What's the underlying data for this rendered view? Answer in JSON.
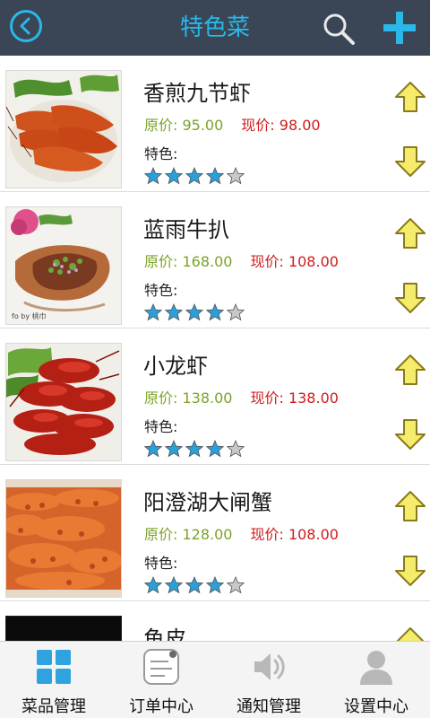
{
  "header": {
    "title": "特色菜",
    "accent_color": "#2ab8ea",
    "background": "#3a4656",
    "back_icon": "back-circle-icon",
    "search_icon": "search-icon",
    "add_icon": "plus-icon"
  },
  "items": [
    {
      "name": "香煎九节虾",
      "orig_label": "原价: 95.00",
      "now_label": "现价: 98.00",
      "feature": "特色:",
      "rating": 4,
      "max_rating": 5
    },
    {
      "name": "蓝雨牛扒",
      "orig_label": "原价: 168.00",
      "now_label": "现价: 108.00",
      "feature": "特色:",
      "rating": 4,
      "max_rating": 5
    },
    {
      "name": "小龙虾",
      "orig_label": "原价: 138.00",
      "now_label": "现价: 138.00",
      "feature": "特色:",
      "rating": 4,
      "max_rating": 5
    },
    {
      "name": "阳澄湖大闸蟹",
      "orig_label": "原价: 128.00",
      "now_label": "现价: 108.00",
      "feature": "特色:",
      "rating": 4,
      "max_rating": 5
    },
    {
      "name": "鱼皮",
      "orig_label": "",
      "now_label": "",
      "feature": "",
      "rating": 0,
      "max_rating": 5
    }
  ],
  "colors": {
    "orig_price": "#7aa324",
    "now_price": "#d01b1b",
    "star_filled": "#2b9fd8",
    "star_empty": "#c8c8c8",
    "arrow_fill": "#f4ec6a",
    "arrow_stroke": "#8a7a1a"
  },
  "bottom_nav": {
    "items": [
      {
        "label": "菜品管理",
        "icon": "grid-icon"
      },
      {
        "label": "订单中心",
        "icon": "order-list-icon"
      },
      {
        "label": "通知管理",
        "icon": "speaker-icon"
      },
      {
        "label": "设置中心",
        "icon": "user-icon"
      }
    ]
  }
}
